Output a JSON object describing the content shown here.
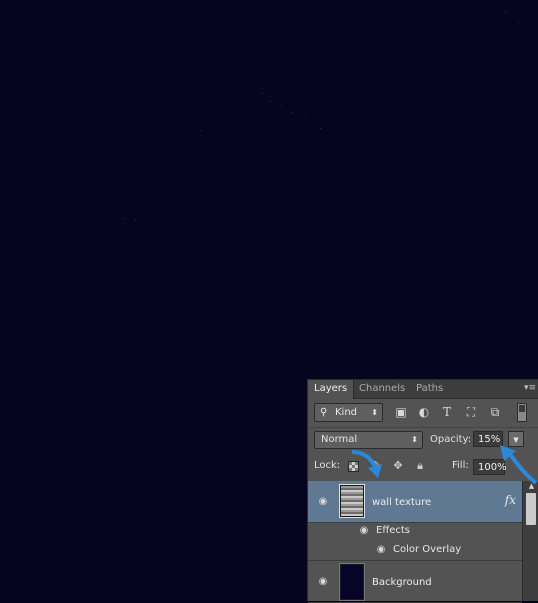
{
  "panel": {
    "tabs": [
      "Layers",
      "Channels",
      "Paths"
    ],
    "active_tab": "Layers",
    "kind_filter": "Kind",
    "blend_mode": "Normal",
    "opacity_label": "Opacity:",
    "opacity_value": "15%",
    "lock_label": "Lock:",
    "fill_label": "Fill:",
    "fill_value": "100%"
  },
  "layers": [
    {
      "name": "wall texture",
      "selected": true,
      "has_fx": true,
      "fx_label": "fx"
    },
    {
      "name": "Effects"
    },
    {
      "name": "Color Overlay"
    },
    {
      "name": "Background",
      "selected": false
    }
  ],
  "colors": {
    "canvas": "#06051f",
    "panel": "#535353",
    "selected_layer": "#5f7993",
    "annotation_arrow": "#2a8ad9"
  },
  "icons": {
    "search": "search-icon",
    "image_filter": "image-filter-icon",
    "adjustment_filter": "adjustment-filter-icon",
    "type_filter": "type-filter-icon",
    "shape_filter": "shape-filter-icon",
    "smart_object_filter": "smart-object-filter-icon",
    "panel_menu": "panel-menu-icon",
    "eye": "eye-icon",
    "lock_pixels": "brush-lock-icon",
    "lock_position": "move-lock-icon",
    "lock_all": "padlock-icon"
  }
}
